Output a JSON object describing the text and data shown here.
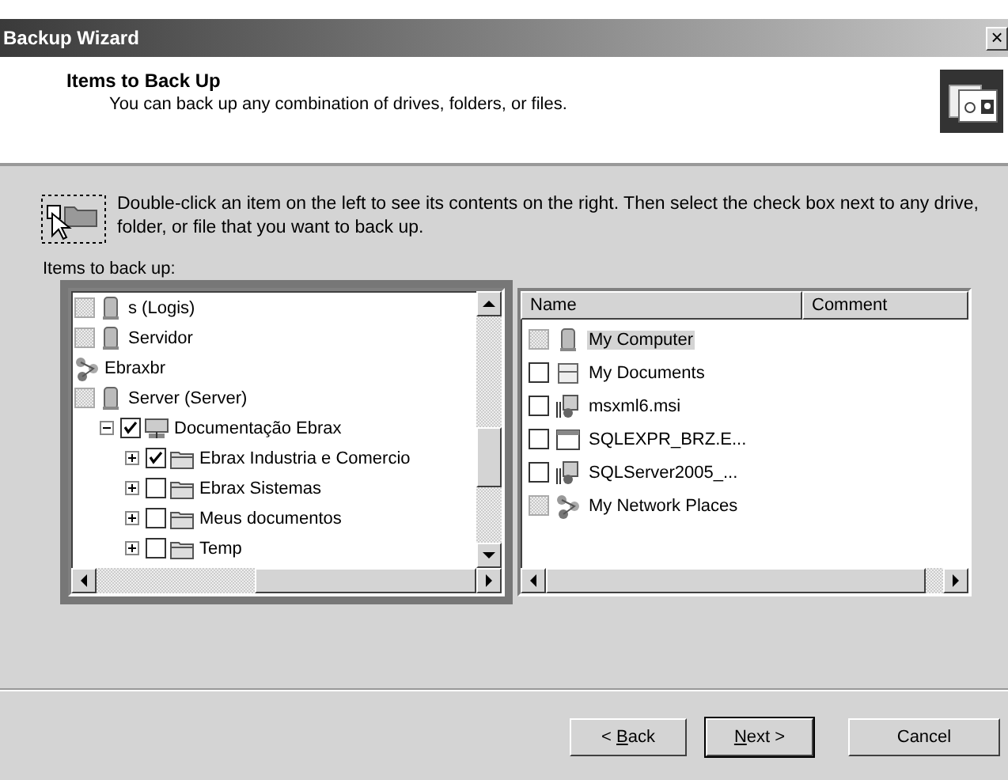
{
  "window": {
    "title": "Backup Wizard",
    "close": "×"
  },
  "header": {
    "title": "Items to Back Up",
    "subtitle": "You can back up any combination of drives, folders, or files."
  },
  "instruction": "Double-click an item on the left to see its contents on the right. Then select the check box next to any drive, folder, or file that you want to back up.",
  "tree": {
    "label": "Items to back up:",
    "items": [
      {
        "name": "s (Logis)",
        "kind": "server",
        "checked": false,
        "partial": true
      },
      {
        "name": "Servidor",
        "kind": "server",
        "checked": false,
        "partial": true
      },
      {
        "name": "Ebraxbr",
        "kind": "network"
      },
      {
        "name": "Server (Server)",
        "kind": "server",
        "checked": false,
        "partial": true,
        "children": [
          {
            "name": "Documentação Ebrax",
            "kind": "share",
            "checked": true,
            "partial": false,
            "expanded": true,
            "children": [
              {
                "name": "Ebrax Industria e Comercio",
                "kind": "folder",
                "checked": true,
                "partial": false,
                "expanded": false
              },
              {
                "name": "Ebrax Sistemas",
                "kind": "folder",
                "checked": false,
                "partial": false,
                "expanded": false
              },
              {
                "name": "Meus documentos",
                "kind": "folder",
                "checked": false,
                "partial": false,
                "expanded": false
              },
              {
                "name": "Temp",
                "kind": "folder",
                "checked": false,
                "partial": false,
                "expanded": false
              }
            ]
          }
        ]
      }
    ]
  },
  "list": {
    "columns": [
      "Name",
      "Comment"
    ],
    "rows": [
      {
        "name": "My Computer",
        "kind": "computer",
        "checked": false,
        "partial": true,
        "selected": true
      },
      {
        "name": "My Documents",
        "kind": "documents",
        "checked": false,
        "partial": false,
        "selected": false
      },
      {
        "name": "msxml6.msi",
        "kind": "installer",
        "checked": false,
        "partial": false,
        "selected": false
      },
      {
        "name": "SQLEXPR_BRZ.E...",
        "kind": "app",
        "checked": false,
        "partial": false,
        "selected": false
      },
      {
        "name": "SQLServer2005_...",
        "kind": "installer",
        "checked": false,
        "partial": false,
        "selected": false
      },
      {
        "name": "My Network Places",
        "kind": "network",
        "checked": false,
        "partial": true,
        "selected": false
      }
    ]
  },
  "buttons": [
    {
      "before": "< ",
      "access_key": "B",
      "after": "ack",
      "default": false
    },
    {
      "access_key": "N",
      "after": "ext >",
      "default": true
    },
    {
      "before": "Cancel",
      "default": false
    }
  ]
}
